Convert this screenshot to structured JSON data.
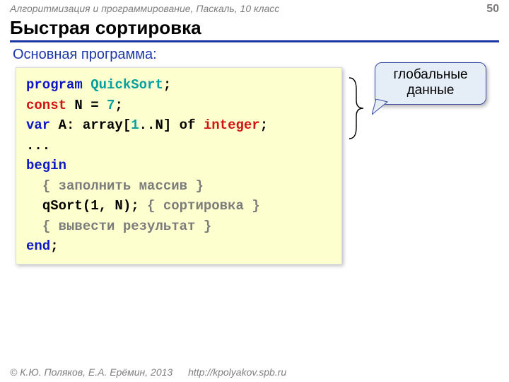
{
  "header": {
    "course": "Алгоритмизация и программирование, Паскаль, 10 класс",
    "page": "50"
  },
  "title": "Быстрая сортировка",
  "subtitle": "Основная программа:",
  "callout": {
    "line1": "глобальные",
    "line2": "данные"
  },
  "code": {
    "l1_kw": "program",
    "l1_name": "QuickSort",
    "l1_semi": ";",
    "l2_kw": "const",
    "l2_rest1": " N",
    "l2_eq": " = ",
    "l2_val": "7",
    "l2_semi": ";",
    "l3_kw": "var",
    "l3_mid": " A: array[",
    "l3_one": "1",
    "l3_mid2": "..N] of ",
    "l3_type": "integer",
    "l3_semi": ";",
    "l4": "...",
    "l5_kw": "begin",
    "l6_indent": "  ",
    "l6_comment": "{ заполнить массив }",
    "l7_indent": "  ",
    "l7_call": "qSort(1, N);",
    "l7_sp": " ",
    "l7_comment": "{ сортировка }",
    "l8_indent": "  ",
    "l8_comment": "{ вывести результат }",
    "l9_kw": "end",
    "l9_semi": ";"
  },
  "footer": {
    "copyright": "© К.Ю. Поляков, Е.А. Ерёмин, 2013",
    "url": "http://kpolyakov.spb.ru"
  }
}
